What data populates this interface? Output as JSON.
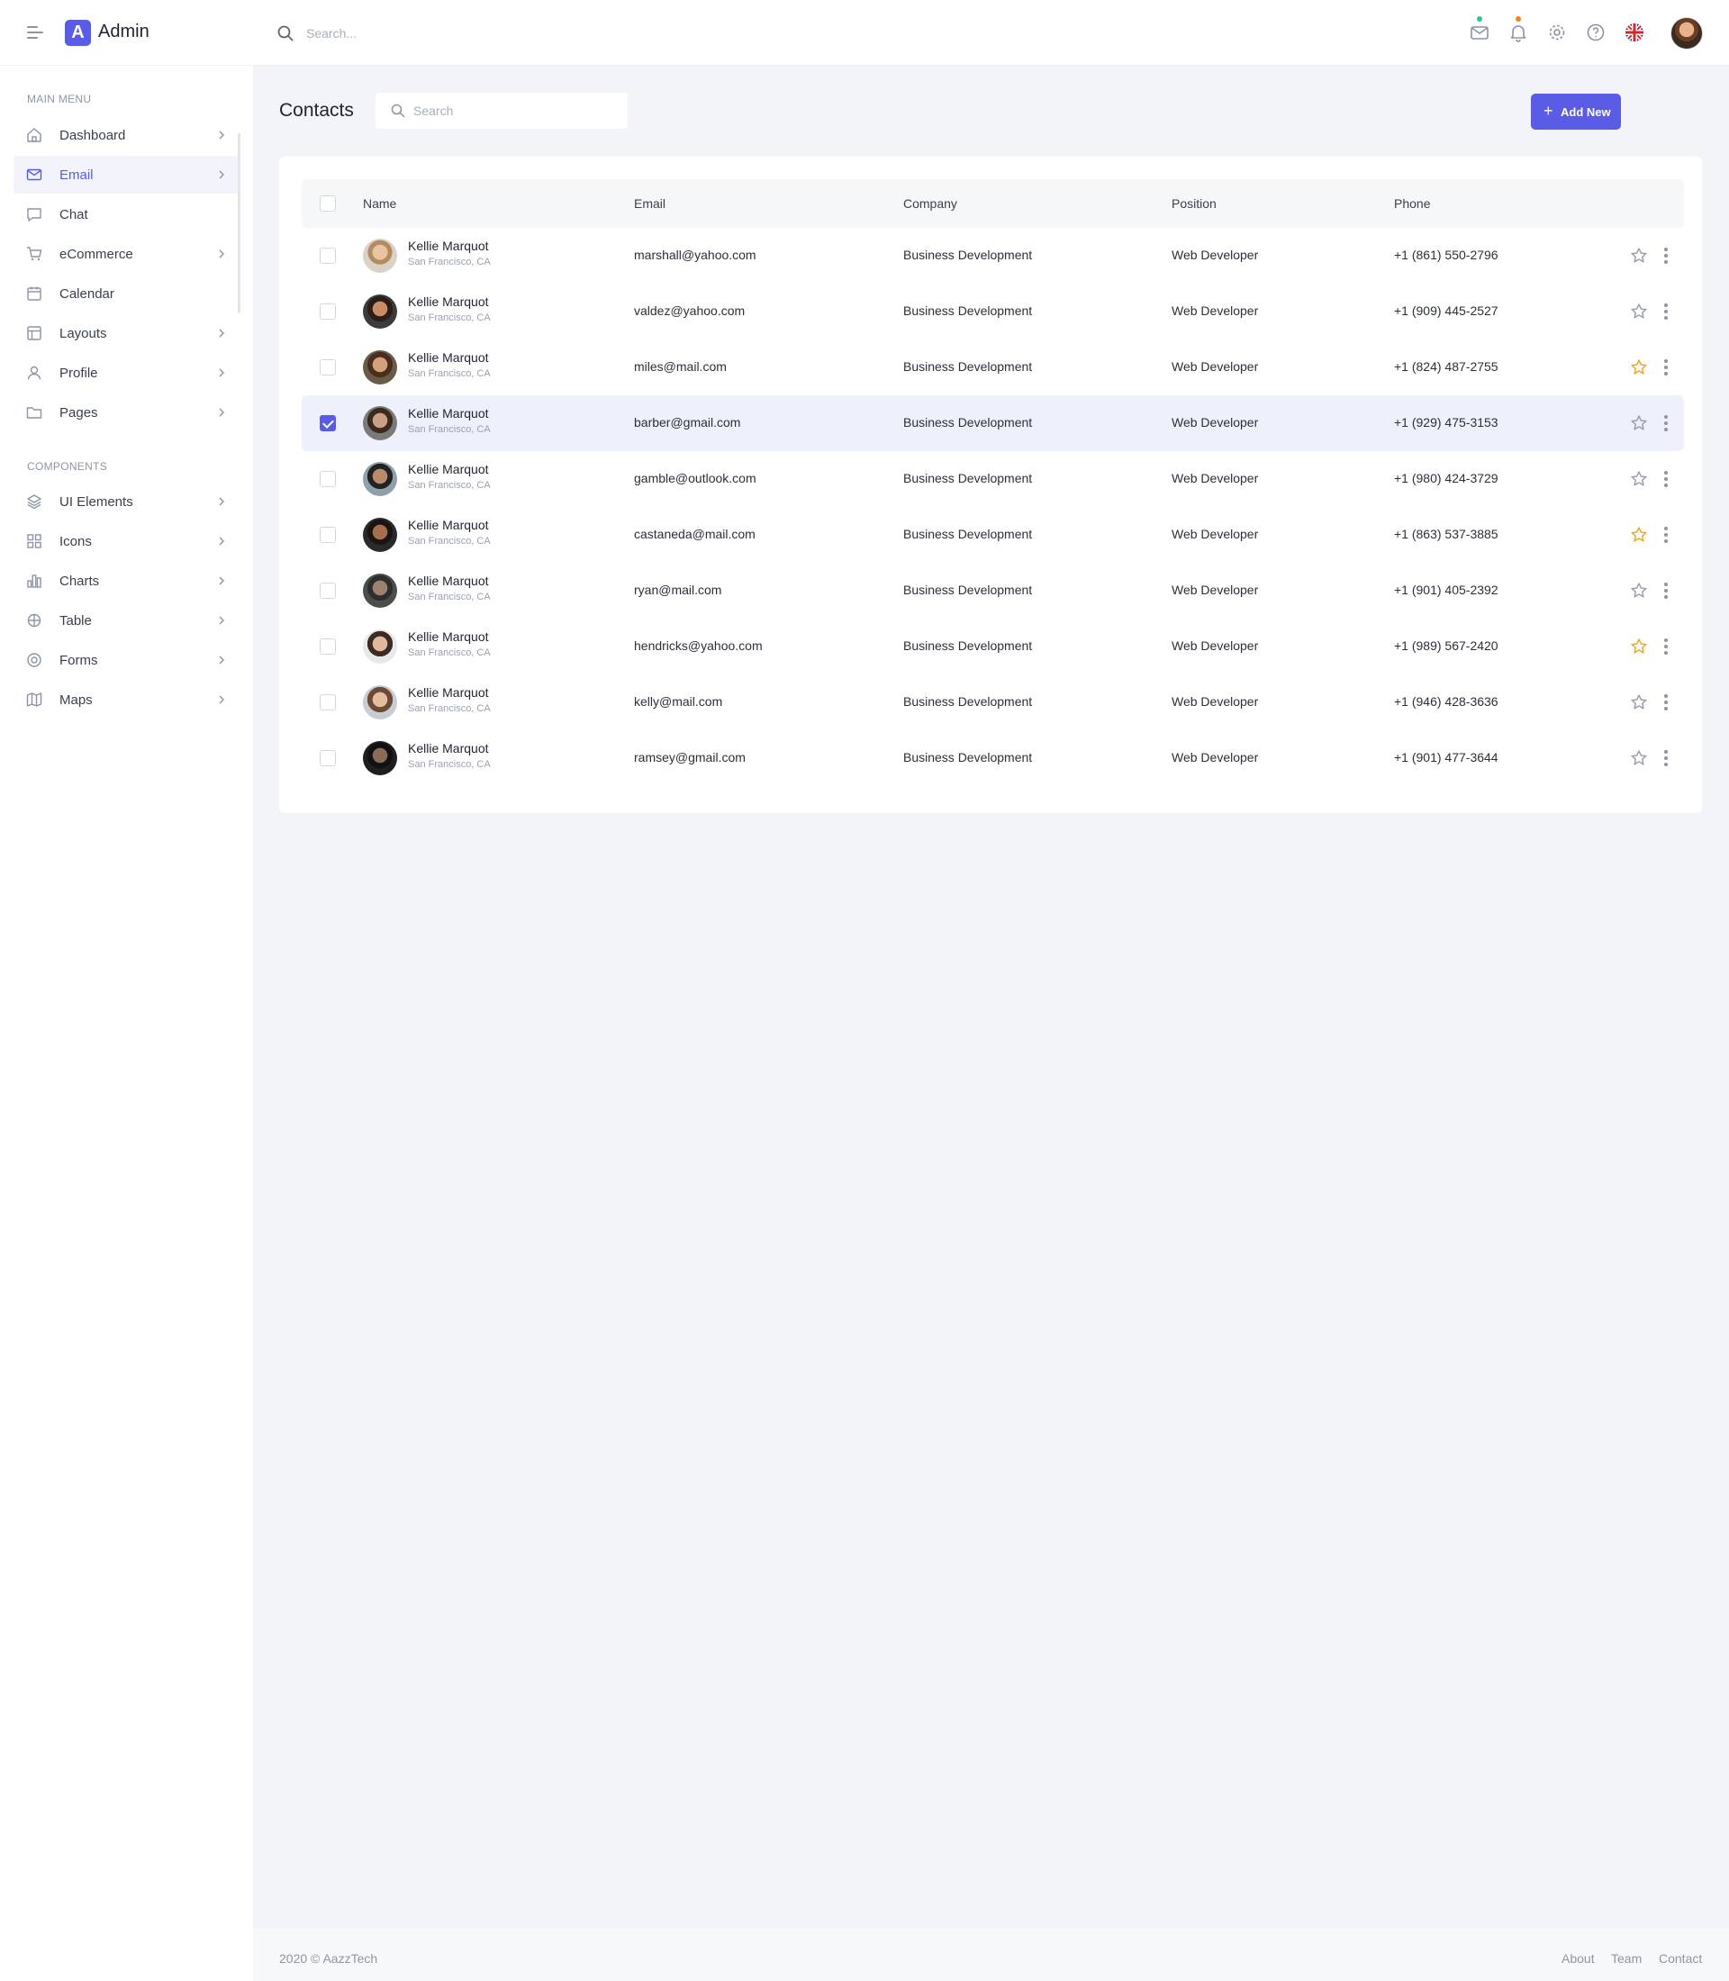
{
  "header": {
    "logo_letter": "A",
    "app_name": "Admin",
    "search_placeholder": "Search...",
    "mail_dot_color": "#20c997",
    "bell_dot_color": "#fd7e14"
  },
  "sidebar": {
    "main_menu_label": "MAIN MENU",
    "components_label": "COMPONENTS",
    "main_items": [
      {
        "label": "Dashboard",
        "icon": "home-icon",
        "has_chevron": true
      },
      {
        "label": "Email",
        "icon": "mail-icon",
        "has_chevron": true,
        "active": true
      },
      {
        "label": "Chat",
        "icon": "chat-icon",
        "has_chevron": false
      },
      {
        "label": "eCommerce",
        "icon": "cart-icon",
        "has_chevron": true
      },
      {
        "label": "Calendar",
        "icon": "calendar-icon",
        "has_chevron": false
      },
      {
        "label": "Layouts",
        "icon": "layout-icon",
        "has_chevron": true
      },
      {
        "label": "Profile",
        "icon": "user-icon",
        "has_chevron": true
      },
      {
        "label": "Pages",
        "icon": "folder-icon",
        "has_chevron": true
      }
    ],
    "component_items": [
      {
        "label": "UI Elements",
        "icon": "layers-icon",
        "has_chevron": true
      },
      {
        "label": "Icons",
        "icon": "grid-icon",
        "has_chevron": true
      },
      {
        "label": "Charts",
        "icon": "bar-chart-icon",
        "has_chevron": true
      },
      {
        "label": "Table",
        "icon": "table-icon",
        "has_chevron": true
      },
      {
        "label": "Forms",
        "icon": "form-icon",
        "has_chevron": true
      },
      {
        "label": "Maps",
        "icon": "map-icon",
        "has_chevron": true
      }
    ]
  },
  "main": {
    "title": "Contacts",
    "search_placeholder": "Search",
    "add_button": "Add New",
    "columns": {
      "name": "Name",
      "email": "Email",
      "company": "Company",
      "position": "Position",
      "phone": "Phone"
    },
    "rows": [
      {
        "name": "Kellie Marquot",
        "location": "San Francisco, CA",
        "email": "marshall@yahoo.com",
        "company": "Business Development",
        "position": "Web Developer",
        "phone": "+1 (861) 550-2796",
        "starred": false,
        "checked": false
      },
      {
        "name": "Kellie Marquot",
        "location": "San Francisco, CA",
        "email": "valdez@yahoo.com",
        "company": "Business Development",
        "position": "Web Developer",
        "phone": "+1 (909) 445-2527",
        "starred": false,
        "checked": false
      },
      {
        "name": "Kellie Marquot",
        "location": "San Francisco, CA",
        "email": "miles@mail.com",
        "company": "Business Development",
        "position": "Web Developer",
        "phone": "+1 (824) 487-2755",
        "starred": true,
        "checked": false
      },
      {
        "name": "Kellie Marquot",
        "location": "San Francisco, CA",
        "email": "barber@gmail.com",
        "company": "Business Development",
        "position": "Web Developer",
        "phone": "+1 (929) 475-3153",
        "starred": false,
        "checked": true
      },
      {
        "name": "Kellie Marquot",
        "location": "San Francisco, CA",
        "email": "gamble@outlook.com",
        "company": "Business Development",
        "position": "Web Developer",
        "phone": "+1 (980) 424-3729",
        "starred": false,
        "checked": false
      },
      {
        "name": "Kellie Marquot",
        "location": "San Francisco, CA",
        "email": "castaneda@mail.com",
        "company": "Business Development",
        "position": "Web Developer",
        "phone": "+1 (863) 537-3885",
        "starred": true,
        "checked": false
      },
      {
        "name": "Kellie Marquot",
        "location": "San Francisco, CA",
        "email": "ryan@mail.com",
        "company": "Business Development",
        "position": "Web Developer",
        "phone": "+1 (901) 405-2392",
        "starred": false,
        "checked": false
      },
      {
        "name": "Kellie Marquot",
        "location": "San Francisco, CA",
        "email": "hendricks@yahoo.com",
        "company": "Business Development",
        "position": "Web Developer",
        "phone": "+1 (989) 567-2420",
        "starred": true,
        "checked": false
      },
      {
        "name": "Kellie Marquot",
        "location": "San Francisco, CA",
        "email": "kelly@mail.com",
        "company": "Business Development",
        "position": "Web Developer",
        "phone": "+1 (946) 428-3636",
        "starred": false,
        "checked": false
      },
      {
        "name": "Kellie Marquot",
        "location": "San Francisco, CA",
        "email": "ramsey@gmail.com",
        "company": "Business Development",
        "position": "Web Developer",
        "phone": "+1 (901) 477-3644",
        "starred": false,
        "checked": false
      }
    ]
  },
  "footer": {
    "copyright": "2020 © AazzTech",
    "links": [
      "About",
      "Team",
      "Contact"
    ]
  },
  "colors": {
    "accent": "#5b5ce6",
    "star_active": "#f5a623",
    "star_inactive": "#9aa1b3"
  }
}
